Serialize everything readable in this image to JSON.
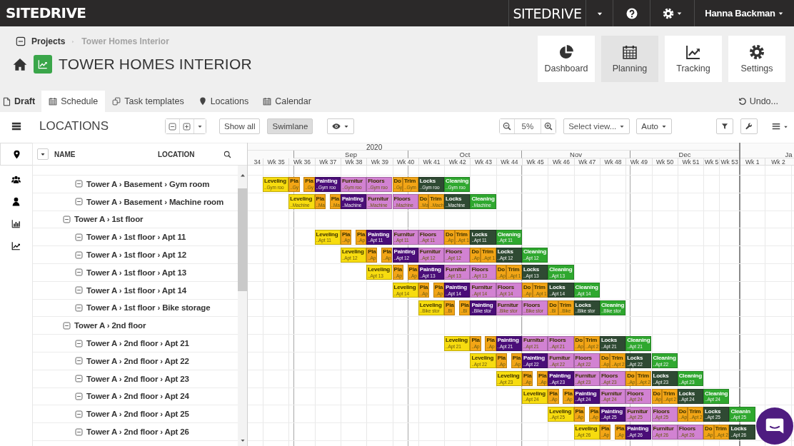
{
  "topbar": {
    "logo": "SITEDRIVE",
    "product": "SITEDRIVE",
    "user": "Hanna Backman"
  },
  "breadcrumb": [
    "Projects",
    "Tower Homes Interior"
  ],
  "project_title": "TOWER HOMES INTERIOR",
  "nav_cards": [
    {
      "label": "Dashboard",
      "selected": false
    },
    {
      "label": "Planning",
      "selected": true
    },
    {
      "label": "Tracking",
      "selected": false
    },
    {
      "label": "Settings",
      "selected": false
    }
  ],
  "status": "Draft",
  "tabs": [
    {
      "label": "Schedule",
      "selected": true
    },
    {
      "label": "Task templates",
      "selected": false
    },
    {
      "label": "Locations",
      "selected": false
    },
    {
      "label": "Calendar",
      "selected": false
    }
  ],
  "undo": "Undo...",
  "toolbar": {
    "title": "LOCATIONS",
    "show_all": "Show all",
    "swimlane": {
      "label": "Swimlane",
      "selected": true
    },
    "zoom": "5%",
    "view_select": {
      "placeholder": "Select view..."
    },
    "mode": "Auto"
  },
  "sidebar_tabs": [
    {
      "selected": true
    },
    {
      "selected": false
    },
    {
      "selected": false
    },
    {
      "selected": false
    },
    {
      "selected": false
    }
  ],
  "locations": {
    "columns": [
      "NAME",
      "LOCATION"
    ],
    "rows": [
      {
        "children": [
          {
            "label": "Tower A › Basement › Gym room",
            "tasks": [
              {
                "name": "Leveling",
                "sub": "..Gym roo",
                "color": "#f7dc0f"
              },
              {
                "name": "Pla",
                "sub": "..Gy",
                "color": "#f2a516"
              },
              {
                "name": "Pla",
                "sub": "..Gy",
                "color": "#f2a516"
              },
              {
                "name": "Painting",
                "sub": "..Gym roo",
                "color": "#4a0d78"
              },
              {
                "name": "Furnitur",
                "sub": "..Gym roo",
                "color": "#d282d2"
              },
              {
                "name": "Floors",
                "sub": "..Gym roo",
                "color": "#d282d2"
              },
              {
                "name": "Do",
                "sub": "..Gy",
                "color": "#f2a516"
              },
              {
                "name": "Trim",
                "sub": "..Gym",
                "color": "#f2a516"
              },
              {
                "name": "Locks",
                "sub": "..Gym roo",
                "color": "#2f4a33"
              },
              {
                "name": "Cleaning",
                "sub": "..Gym roo",
                "color": "#2fa82f"
              }
            ]
          },
          {
            "label": "Tower A › Basement › Machine room",
            "tasks": [
              {
                "name": "Leveling",
                "sub": "..Machine",
                "color": "#f7dc0f"
              },
              {
                "name": "Pla",
                "sub": "..Ma",
                "color": "#f2a516"
              },
              {
                "name": "Pla",
                "sub": "..Ma",
                "color": "#f2a516"
              },
              {
                "name": "Painting",
                "sub": "..Machine",
                "color": "#4a0d78"
              },
              {
                "name": "Furnitur",
                "sub": "..Machine",
                "color": "#d282d2"
              },
              {
                "name": "Floors",
                "sub": "..Machine",
                "color": "#d282d2"
              },
              {
                "name": "Do",
                "sub": "..Ma",
                "color": "#f2a516"
              },
              {
                "name": "Trim",
                "sub": "..Mach",
                "color": "#f2a516"
              },
              {
                "name": "Locks",
                "sub": "..Machine",
                "color": "#2f4a33"
              },
              {
                "name": "Cleaning",
                "sub": "..Machine",
                "color": "#2fa82f"
              }
            ]
          }
        ]
      },
      {
        "label": "Tower A › 1st floor",
        "children": [
          {
            "label": "Tower A › 1st floor › Apt 11",
            "tasks": [
              {
                "name": "Leveling",
                "sub": "..Apt 11",
                "color": "#f7dc0f"
              },
              {
                "name": "Pla",
                "sub": "..Ap",
                "color": "#f2a516"
              },
              {
                "name": "Pla",
                "sub": "..Ap",
                "color": "#f2a516"
              },
              {
                "name": "Painting",
                "sub": "..Apt 11",
                "color": "#4a0d78"
              },
              {
                "name": "Furnitur",
                "sub": "..Apt 11",
                "color": "#d282d2"
              },
              {
                "name": "Floors",
                "sub": "..Apt 11",
                "color": "#d282d2"
              },
              {
                "name": "Do",
                "sub": "..Ap",
                "color": "#f2a516"
              },
              {
                "name": "Trim",
                "sub": "..Apt 1",
                "color": "#f2a516"
              },
              {
                "name": "Locks",
                "sub": "..Apt 11",
                "color": "#2f4a33"
              },
              {
                "name": "Cleaning",
                "sub": "..Apt 11",
                "color": "#2fa82f"
              }
            ]
          },
          {
            "label": "Tower A › 1st floor › Apt 12",
            "tasks": [
              {
                "name": "Leveling",
                "sub": "..Apt 12",
                "color": "#f7dc0f"
              },
              {
                "name": "Pla",
                "sub": "..Ap",
                "color": "#f2a516"
              },
              {
                "name": "Pla",
                "sub": "..Ap",
                "color": "#f2a516"
              },
              {
                "name": "Painting",
                "sub": "..Apt 12",
                "color": "#4a0d78"
              },
              {
                "name": "Furnitur",
                "sub": "..Apt 12",
                "color": "#d282d2"
              },
              {
                "name": "Floors",
                "sub": "..Apt 12",
                "color": "#d282d2"
              },
              {
                "name": "Do",
                "sub": "..Ap",
                "color": "#f2a516"
              },
              {
                "name": "Trim",
                "sub": "..Apt 1",
                "color": "#f2a516"
              },
              {
                "name": "Locks",
                "sub": "..Apt 12",
                "color": "#2f4a33"
              },
              {
                "name": "Cleaning",
                "sub": "..Apt 12",
                "color": "#2fa82f"
              }
            ]
          },
          {
            "label": "Tower A › 1st floor › Apt 13",
            "tasks": [
              {
                "name": "Leveling",
                "sub": "..Apt 13",
                "color": "#f7dc0f"
              },
              {
                "name": "Pla",
                "sub": "..Ap",
                "color": "#f2a516"
              },
              {
                "name": "Pla",
                "sub": "..Ap",
                "color": "#f2a516"
              },
              {
                "name": "Painting",
                "sub": "..Apt 13",
                "color": "#4a0d78"
              },
              {
                "name": "Furnitur",
                "sub": "..Apt 13",
                "color": "#d282d2"
              },
              {
                "name": "Floors",
                "sub": "..Apt 13",
                "color": "#d282d2"
              },
              {
                "name": "Do",
                "sub": "..Ap",
                "color": "#f2a516"
              },
              {
                "name": "Trim",
                "sub": "..Apt 1",
                "color": "#f2a516"
              },
              {
                "name": "Locks",
                "sub": "..Apt 13",
                "color": "#2f4a33"
              },
              {
                "name": "Cleaning",
                "sub": "..Apt 13",
                "color": "#2fa82f"
              }
            ]
          },
          {
            "label": "Tower A › 1st floor › Apt 14",
            "tasks": [
              {
                "name": "Leveling",
                "sub": "..Apt 14",
                "color": "#f7dc0f"
              },
              {
                "name": "Pla",
                "sub": "..Ap",
                "color": "#f2a516"
              },
              {
                "name": "Pla",
                "sub": "..Ap",
                "color": "#f2a516"
              },
              {
                "name": "Painting",
                "sub": "..Apt 14",
                "color": "#4a0d78"
              },
              {
                "name": "Furnitur",
                "sub": "..Apt 14",
                "color": "#d282d2"
              },
              {
                "name": "Floors",
                "sub": "..Apt 14",
                "color": "#d282d2"
              },
              {
                "name": "Do",
                "sub": "..Ap",
                "color": "#f2a516"
              },
              {
                "name": "Trim",
                "sub": "..Apt 1",
                "color": "#f2a516"
              },
              {
                "name": "Locks",
                "sub": "..Apt 14",
                "color": "#2f4a33"
              },
              {
                "name": "Cleaning",
                "sub": "..Apt 14",
                "color": "#2fa82f"
              }
            ]
          },
          {
            "label": "Tower A › 1st floor › Bike storage",
            "tasks": [
              {
                "name": "Leveling",
                "sub": "..Bike stor",
                "color": "#f7dc0f"
              },
              {
                "name": "Pla",
                "sub": "..Bi",
                "color": "#f2a516"
              },
              {
                "name": "Pla",
                "sub": "..Bi",
                "color": "#f2a516"
              },
              {
                "name": "Painting",
                "sub": "..Bike stor",
                "color": "#4a0d78"
              },
              {
                "name": "Furnitur",
                "sub": "..Bike stor",
                "color": "#d282d2"
              },
              {
                "name": "Floors",
                "sub": "..Bike stor",
                "color": "#d282d2"
              },
              {
                "name": "Do",
                "sub": "..Bi",
                "color": "#f2a516"
              },
              {
                "name": "Trim",
                "sub": "..Bike",
                "color": "#f2a516"
              },
              {
                "name": "Locks",
                "sub": "..Bike stor",
                "color": "#2f4a33"
              },
              {
                "name": "Cleaning",
                "sub": "..Bike stor",
                "color": "#2fa82f"
              }
            ]
          }
        ]
      },
      {
        "label": "Tower A › 2nd floor",
        "children": [
          {
            "label": "Tower A › 2nd floor › Apt 21",
            "tasks": [
              {
                "name": "Leveling",
                "sub": "..Apt 21",
                "color": "#f7dc0f"
              },
              {
                "name": "Pla",
                "sub": "..Ap",
                "color": "#f2a516"
              },
              {
                "name": "Pla",
                "sub": "..Ap",
                "color": "#f2a516"
              },
              {
                "name": "Painting",
                "sub": "..Apt 21",
                "color": "#4a0d78"
              },
              {
                "name": "Furnitur",
                "sub": "..Apt 21",
                "color": "#d282d2"
              },
              {
                "name": "Floors",
                "sub": "..Apt 21",
                "color": "#d282d2"
              },
              {
                "name": "Do",
                "sub": "..Ap",
                "color": "#f2a516"
              },
              {
                "name": "Trim",
                "sub": "..Apt 2",
                "color": "#f2a516"
              },
              {
                "name": "Locks",
                "sub": "..Apt 21",
                "color": "#2f4a33"
              },
              {
                "name": "Cleaning",
                "sub": "..Apt 21",
                "color": "#2fa82f"
              }
            ]
          },
          {
            "label": "Tower A › 2nd floor › Apt 22",
            "tasks": [
              {
                "name": "Leveling",
                "sub": "..Apt 22",
                "color": "#f7dc0f"
              },
              {
                "name": "Pla",
                "sub": "..Ap",
                "color": "#f2a516"
              },
              {
                "name": "Pla",
                "sub": "..Ap",
                "color": "#f2a516"
              },
              {
                "name": "Painting",
                "sub": "..Apt 22",
                "color": "#4a0d78"
              },
              {
                "name": "Furnitur",
                "sub": "..Apt 22",
                "color": "#d282d2"
              },
              {
                "name": "Floors",
                "sub": "..Apt 22",
                "color": "#d282d2"
              },
              {
                "name": "Do",
                "sub": "..Ap",
                "color": "#f2a516"
              },
              {
                "name": "Trim",
                "sub": "..Apt 2",
                "color": "#f2a516"
              },
              {
                "name": "Locks",
                "sub": "..Apt 22",
                "color": "#2f4a33"
              },
              {
                "name": "Cleaning",
                "sub": "..Apt 22",
                "color": "#2fa82f"
              }
            ]
          },
          {
            "label": "Tower A › 2nd floor › Apt 23",
            "tasks": [
              {
                "name": "Leveling",
                "sub": "..Apt 23",
                "color": "#f7dc0f"
              },
              {
                "name": "Pla",
                "sub": "..Ap",
                "color": "#f2a516"
              },
              {
                "name": "Pla",
                "sub": "..Ap",
                "color": "#f2a516"
              },
              {
                "name": "Painting",
                "sub": "..Apt 23",
                "color": "#4a0d78"
              },
              {
                "name": "Furnitur",
                "sub": "..Apt 23",
                "color": "#d282d2"
              },
              {
                "name": "Floors",
                "sub": "..Apt 23",
                "color": "#d282d2"
              },
              {
                "name": "Do",
                "sub": "..Ap",
                "color": "#f2a516"
              },
              {
                "name": "Trim",
                "sub": "..Apt 2",
                "color": "#f2a516"
              },
              {
                "name": "Locks",
                "sub": "..Apt 23",
                "color": "#2f4a33"
              },
              {
                "name": "Cleaning",
                "sub": "..Apt 23",
                "color": "#2fa82f"
              }
            ]
          },
          {
            "label": "Tower A › 2nd floor › Apt 24",
            "tasks": [
              {
                "name": "Leveling",
                "sub": "..Apt 24",
                "color": "#f7dc0f"
              },
              {
                "name": "Pla",
                "sub": "..Ap",
                "color": "#f2a516"
              },
              {
                "name": "Pla",
                "sub": "..Ap",
                "color": "#f2a516"
              },
              {
                "name": "Painting",
                "sub": "..Apt 24",
                "color": "#4a0d78"
              },
              {
                "name": "Furnitur",
                "sub": "..Apt 24",
                "color": "#d282d2"
              },
              {
                "name": "Floors",
                "sub": "..Apt 24",
                "color": "#d282d2"
              },
              {
                "name": "Do",
                "sub": "..Ap",
                "color": "#f2a516"
              },
              {
                "name": "Trim",
                "sub": "..Apt 2",
                "color": "#f2a516"
              },
              {
                "name": "Locks",
                "sub": "..Apt 24",
                "color": "#2f4a33"
              },
              {
                "name": "Cleaning",
                "sub": "..Apt 24",
                "color": "#2fa82f"
              }
            ]
          },
          {
            "label": "Tower A › 2nd floor › Apt 25",
            "tasks": [
              {
                "name": "Leveling",
                "sub": "..Apt 25",
                "color": "#f7dc0f"
              },
              {
                "name": "Pla",
                "sub": "..Ap",
                "color": "#f2a516"
              },
              {
                "name": "Pla",
                "sub": "..Ap",
                "color": "#f2a516"
              },
              {
                "name": "Painting",
                "sub": "..Apt 25",
                "color": "#4a0d78"
              },
              {
                "name": "Furnitur",
                "sub": "..Apt 25",
                "color": "#d282d2"
              },
              {
                "name": "Floors",
                "sub": "..Apt 25",
                "color": "#d282d2"
              },
              {
                "name": "Do",
                "sub": "..Ap",
                "color": "#f2a516"
              },
              {
                "name": "Trim",
                "sub": "..Apt 2",
                "color": "#f2a516"
              },
              {
                "name": "Locks",
                "sub": "..Apt 25",
                "color": "#2f4a33"
              },
              {
                "name": "Cleanin",
                "sub": "..Apt 25",
                "color": "#2fa82f"
              }
            ]
          },
          {
            "label": "Tower A › 2nd floor › Apt 26",
            "tasks": [
              {
                "name": "Leveling",
                "sub": "..Apt 26",
                "color": "#f7dc0f"
              },
              {
                "name": "Pla",
                "sub": "..Ap",
                "color": "#f2a516"
              },
              {
                "name": "Pla",
                "sub": "..Ap",
                "color": "#f2a516"
              },
              {
                "name": "Painting",
                "sub": "..Apt 26",
                "color": "#4a0d78"
              },
              {
                "name": "Furnitur",
                "sub": "..Apt 26",
                "color": "#d282d2"
              },
              {
                "name": "Floors",
                "sub": "..Apt 26",
                "color": "#d282d2"
              },
              {
                "name": "Do",
                "sub": "..Ap",
                "color": "#f2a516"
              },
              {
                "name": "Trim",
                "sub": "..Apt 2",
                "color": "#f2a516"
              },
              {
                "name": "Locks",
                "sub": "..Apt 26",
                "color": "#2f4a33"
              }
            ]
          }
        ]
      }
    ]
  },
  "timeline": {
    "year": "2020",
    "months": [
      "Sep",
      "Oct",
      "Nov",
      "Dec",
      "Ja"
    ],
    "weeks": [
      "34",
      "Wk 35",
      "Wk 36",
      "Wk 37",
      "Wk 38",
      "Wk 39",
      "Wk 40",
      "Wk 41",
      "Wk 42",
      "Wk 43",
      "Wk 44",
      "Wk 45",
      "Wk 46",
      "Wk 47",
      "Wk 48",
      "Wk 49",
      "Wk 50",
      "Wk 51",
      "Wk 5",
      "Wk 53",
      "Wk 1",
      "Wk 2"
    ]
  }
}
